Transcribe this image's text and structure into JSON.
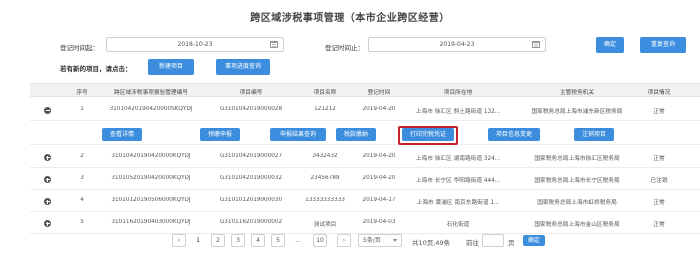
{
  "title": "跨区域涉税事项管理（本市企业跨区经营）",
  "filters": {
    "start_label": "登记时间起：",
    "start_value": "2018-10-23",
    "end_label": "登记时间止：",
    "end_value": "2019-04-23",
    "confirm_label": "确定",
    "reset_label": "重复查询"
  },
  "new_items": {
    "label": "若有新的项目，请点击：",
    "new_button": "新建项目",
    "progress_button": "事项进度查询"
  },
  "table": {
    "headers": [
      "序号",
      "跨区域涉税事项报验管理编号",
      "项目编号",
      "项目名称",
      "登记时间",
      "项目所在地",
      "主管税务机关",
      "项目情况"
    ],
    "rows": [
      {
        "no": "1",
        "code": "31010420190420000SKQYDJ",
        "project_no": "G3101042019000028",
        "name": "121212",
        "date": "2019-04-20",
        "location": "上海市 徐汇区 斜土路街道 132...",
        "authority": "国家税务总局上海市浦东新区税务局",
        "status": "正常"
      },
      {
        "no": "2",
        "code": "31010420190420000KQYDJ",
        "project_no": "G3101042019000027",
        "name": "3432432",
        "date": "2019-04-20",
        "location": "上海市 徐汇区 湖南路街道 324...",
        "authority": "国家税务总局上海市徐汇区税务局",
        "status": "正常"
      },
      {
        "no": "3",
        "code": "31010520190420000KQYDJ",
        "project_no": "G3101042019000032",
        "name": "23456789",
        "date": "2019-04-20",
        "location": "上海市 长宁区 华阳路街道 444...",
        "authority": "国家税务总局上海市长宁区税务局",
        "status": "已注销"
      },
      {
        "no": "4",
        "code": "31010120190506000KQYDJ",
        "project_no": "G3101012019000030",
        "name": "13333333333",
        "date": "2019-04-17",
        "location": "上海市 黄浦区 南京东路街道 1...",
        "authority": "国家税务总局上海市虹桥税务局",
        "status": "正常"
      },
      {
        "no": "5",
        "code": "31011620190403000KQYDJ",
        "project_no": "G3101162019000002",
        "name": "测试项目",
        "date": "2019-04-03",
        "location": "石化街道",
        "authority": "国家税务总局上海市金山区税务局",
        "status": "正常"
      }
    ]
  },
  "row_actions": [
    "查看详情",
    "预缴申报",
    "申报结果查询",
    "税款缴纳",
    "打印完税凭证",
    "项目信息变更",
    "注销项目"
  ],
  "pagination": {
    "pages": [
      "1",
      "2",
      "3",
      "4",
      "5",
      "...",
      "10"
    ],
    "per_page": "5条/页",
    "total": "共10页,49条",
    "goto_label": "前往",
    "page_suffix": "页",
    "confirm": "确定"
  },
  "colors": {
    "accent": "#3c8dde",
    "highlight": "#c8202a"
  },
  "icons": {
    "calendar": "calendar-icon",
    "collapse": "collapse-icon",
    "expand": "expand-icon",
    "prev": "chevron-left-icon",
    "next": "chevron-right-icon"
  }
}
